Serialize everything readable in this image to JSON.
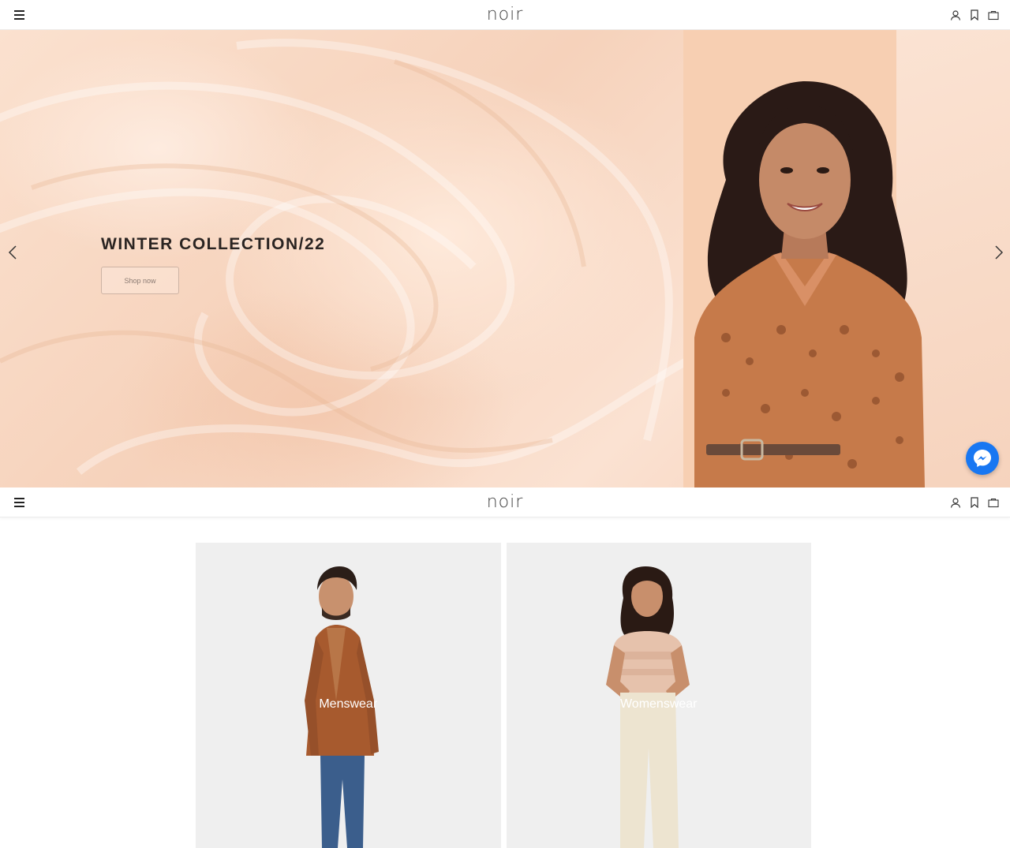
{
  "header": {
    "logo": "noir",
    "icons": [
      "menu-icon",
      "user-icon",
      "bookmark-icon",
      "bag-icon"
    ]
  },
  "hero": {
    "title": "WINTER COLLECTION/22",
    "button_label": "Shop now"
  },
  "categories": [
    {
      "label": "Menswear"
    },
    {
      "label": "Womenswear"
    }
  ],
  "colors": {
    "hero_bg": "#f8d8c3",
    "hero_panel": "#f7cfb2",
    "messenger": "#1877f2",
    "card_bg": "#efefef"
  }
}
